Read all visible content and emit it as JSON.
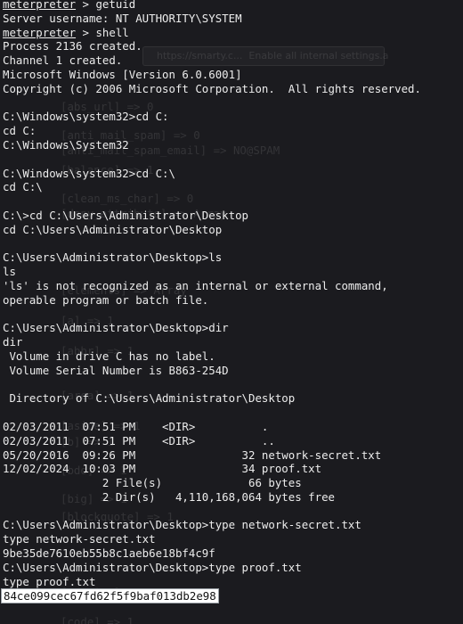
{
  "prompt_word": "meterpreter",
  "prompt_suffix": " > ",
  "lines": [
    {
      "type": "prompt",
      "cmd": "getuid"
    },
    {
      "type": "text",
      "text": "Server username: NT AUTHORITY\\SYSTEM"
    },
    {
      "type": "prompt",
      "cmd": "shell"
    },
    {
      "type": "text",
      "text": "Process 2136 created."
    },
    {
      "type": "text",
      "text": "Channel 1 created."
    },
    {
      "type": "text",
      "text": "Microsoft Windows [Version 6.0.6001]"
    },
    {
      "type": "text",
      "text": "Copyright (c) 2006 Microsoft Corporation.  All rights reserved."
    },
    {
      "type": "text",
      "text": ""
    },
    {
      "type": "text",
      "text": "C:\\Windows\\system32>cd C:"
    },
    {
      "type": "text",
      "text": "cd C:"
    },
    {
      "type": "text",
      "text": "C:\\Windows\\System32"
    },
    {
      "type": "text",
      "text": ""
    },
    {
      "type": "text",
      "text": "C:\\Windows\\system32>cd C:\\"
    },
    {
      "type": "text",
      "text": "cd C:\\"
    },
    {
      "type": "text",
      "text": ""
    },
    {
      "type": "text",
      "text": "C:\\>cd C:\\Users\\Administrator\\Desktop"
    },
    {
      "type": "text",
      "text": "cd C:\\Users\\Administrator\\Desktop"
    },
    {
      "type": "text",
      "text": ""
    },
    {
      "type": "text",
      "text": "C:\\Users\\Administrator\\Desktop>ls"
    },
    {
      "type": "text",
      "text": "ls"
    },
    {
      "type": "text",
      "text": "'ls' is not recognized as an internal or external command,"
    },
    {
      "type": "text",
      "text": "operable program or batch file."
    },
    {
      "type": "text",
      "text": ""
    },
    {
      "type": "text",
      "text": "C:\\Users\\Administrator\\Desktop>dir"
    },
    {
      "type": "text",
      "text": "dir"
    },
    {
      "type": "text",
      "text": " Volume in drive C has no label."
    },
    {
      "type": "text",
      "text": " Volume Serial Number is B863-254D"
    },
    {
      "type": "text",
      "text": ""
    },
    {
      "type": "text",
      "text": " Directory of C:\\Users\\Administrator\\Desktop"
    },
    {
      "type": "text",
      "text": ""
    },
    {
      "type": "text",
      "text": "02/03/2011  07:51 PM    <DIR>          ."
    },
    {
      "type": "text",
      "text": "02/03/2011  07:51 PM    <DIR>          .."
    },
    {
      "type": "text",
      "text": "05/20/2016  09:26 PM                32 network-secret.txt"
    },
    {
      "type": "text",
      "text": "12/02/2024  10:03 PM                34 proof.txt"
    },
    {
      "type": "text",
      "text": "               2 File(s)             66 bytes"
    },
    {
      "type": "text",
      "text": "               2 Dir(s)   4,110,168,064 bytes free"
    },
    {
      "type": "text",
      "text": ""
    },
    {
      "type": "text",
      "text": "C:\\Users\\Administrator\\Desktop>type network-secret.txt"
    },
    {
      "type": "text",
      "text": "type network-secret.txt"
    },
    {
      "type": "text",
      "text": "9be35de7610eb55b8c1aeb6e18bf4c9f"
    },
    {
      "type": "text",
      "text": "C:\\Users\\Administrator\\Desktop>type proof.txt"
    },
    {
      "type": "text",
      "text": "type proof.txt"
    },
    {
      "type": "highlight",
      "text": "84ce099cec67fd62f5f9baf013db2e98"
    }
  ],
  "background_ghost_lines": [
    "[abs_url] => 0",
    "[anti_mail_spam] => 0",
    "[anti_mail_spam_email] => NO@SPAM",
    "[balance] => 1",
    "[clean_ms_char] => 0",
    "[deny_attribute] => Array",
    "[elements] => Array",
    "[a] => 1",
    "[abbr] => 1",
    "[area] => 1",
    "[aside] => 1",
    "[b] => 1",
    "[bdo] => 1",
    "[big] => 1",
    "[blockquote] => 1",
    "[caption] => 1",
    "[code] => 1"
  ],
  "background_ghost_browser": "https://smarty.c...  Enable all internal settings.a",
  "colors": {
    "background": "#1b1b1f",
    "text": "#ececec",
    "highlight_bg": "#ffffff",
    "highlight_text": "#111111"
  }
}
